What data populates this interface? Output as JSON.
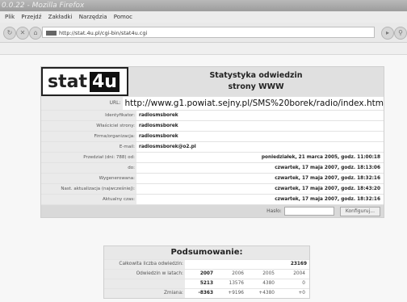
{
  "window": {
    "title": "0.0.22 - Mozilla Firefox"
  },
  "menu": [
    "Plik",
    "Przejdź",
    "Zakładki",
    "Narzędzia",
    "Pomoc"
  ],
  "address": {
    "url": "http://stat.4u.pl/cgi-bin/stat4u.cgi"
  },
  "logo": {
    "text": "stat",
    "number": "4u"
  },
  "header": {
    "line1": "Statystyka odwiedzin",
    "line2": "strony WWW"
  },
  "details": [
    {
      "label": "URL:",
      "value": "http://www.g1.powiat.sejny.pl/SMS%20borek/radio/index.htm"
    },
    {
      "label": "Identyfikator:",
      "value": "radiosmsborek"
    },
    {
      "label": "Właściciel strony:",
      "value": "radiosmsborek"
    },
    {
      "label": "Firma/organizacja:",
      "value": "radiosmsborek"
    },
    {
      "label": "E-mail:",
      "value": "radiosmsborek@o2.pl"
    },
    {
      "label": "Przedział (dni: 788) od:",
      "value": "poniedziałek, 21 marca 2005, godz. 11:00:18"
    },
    {
      "label": "do:",
      "value": "czwartek, 17 maja 2007, godz. 18:13:06"
    },
    {
      "label": "Wygenerowana:",
      "value": "czwartek, 17 maja 2007, godz. 18:32:16"
    },
    {
      "label": "Nast. aktualizacja (najwcześniej):",
      "value": "czwartek, 17 maja 2007, godz. 18:43:20"
    },
    {
      "label": "Aktualny czas:",
      "value": "czwartek, 17 maja 2007, godz. 18:32:16"
    }
  ],
  "password": {
    "label": "Hasło:",
    "button": "Konfiguruj..."
  },
  "summary": {
    "title": "Podsumowanie:",
    "total_label": "Całkowita liczba odwiedzin:",
    "total_value": "23169",
    "years_label": "Odwiedzin w latach:",
    "years": [
      "2007",
      "2006",
      "2005",
      "2004"
    ],
    "counts": [
      "5213",
      "13576",
      "4380",
      "0"
    ],
    "change_label": "Zmiana:",
    "changes": [
      "-8363",
      "+9196",
      "+4380",
      "+0"
    ]
  }
}
